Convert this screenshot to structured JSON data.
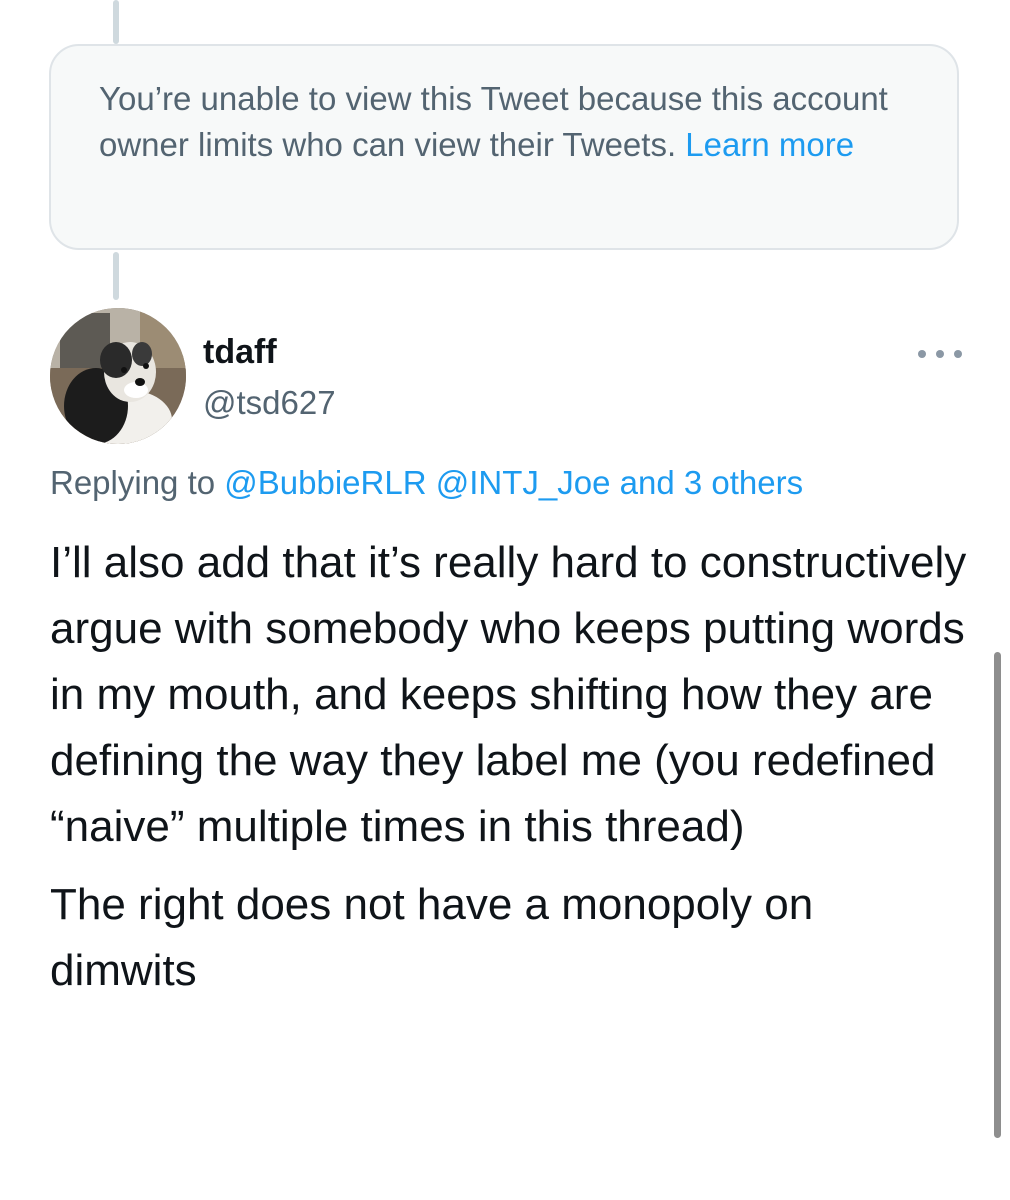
{
  "unavailable_notice": {
    "text": "You’re unable to view this Tweet because this account owner limits who can view their Tweets. ",
    "link_label": "Learn more"
  },
  "tweet": {
    "author": {
      "display_name": "tdaff",
      "handle": "@tsd627"
    },
    "reply_context": {
      "prefix": "Replying to ",
      "mentions": [
        "@BubbieRLR",
        "@INTJ_Joe"
      ],
      "others_label": "and 3 others"
    },
    "paragraphs": [
      "I’ll also add that it’s really hard to constructively argue with somebody who keeps putting words in my mouth, and keeps shifting how they are defining the way they label me (you redefined “naive” multiple times in this thread)",
      "The right does not have a monopoly on dimwits"
    ]
  },
  "icons": {
    "more": "more-horizontal-icon",
    "avatar": "dog-avatar"
  },
  "colors": {
    "link": "#1d9bf0",
    "secondary_text": "#536471",
    "primary_text": "#0f1419",
    "notice_background": "#f7f9f9"
  }
}
